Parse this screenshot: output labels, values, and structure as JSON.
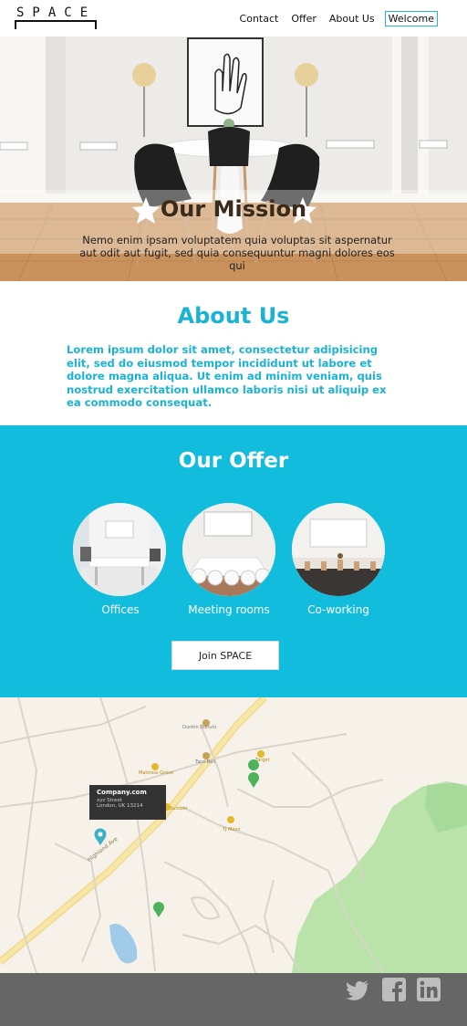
{
  "logo": {
    "text": "SPACE"
  },
  "nav": {
    "items": [
      "Contact",
      "Offer",
      "About Us",
      "Welcome"
    ],
    "active": "Welcome"
  },
  "hero": {
    "title": "Our Mission",
    "text": "Nemo enim ipsam voluptatem quia voluptas sit aspernatur aut odit aut fugit, sed quia consequuntur magni dolores eos qui"
  },
  "about": {
    "title": "About Us",
    "text": "Lorem ipsum dolor sit amet, consectetur adipisicing elit, sed do eiusmod tempor incididunt ut labore et dolore magna aliqua. Ut enim ad minim veniam, quis nostrud exercitation ullamco laboris nisi ut aliquip ex ea commodo consequat."
  },
  "offer": {
    "title": "Our Offer",
    "items": [
      {
        "label": "Offices"
      },
      {
        "label": "Meeting rooms"
      },
      {
        "label": "Co-working"
      }
    ],
    "button": "Join SPACE"
  },
  "map": {
    "tooltip": {
      "name": "Company.com",
      "street": "xyz Street",
      "city": "London, UK 13214"
    },
    "places": [
      "Dunkin Donuts",
      "Target",
      "Taco Bell",
      "Mattress Grove",
      "Sumber",
      "TJ Maxx"
    ],
    "road_label": "Highland Ave"
  },
  "footer": {
    "icons": [
      "twitter-icon",
      "facebook-icon",
      "linkedin-icon"
    ]
  },
  "colors": {
    "accent": "#12bcdd",
    "footer": "#666666",
    "hero_title": "#3a2a1a"
  }
}
